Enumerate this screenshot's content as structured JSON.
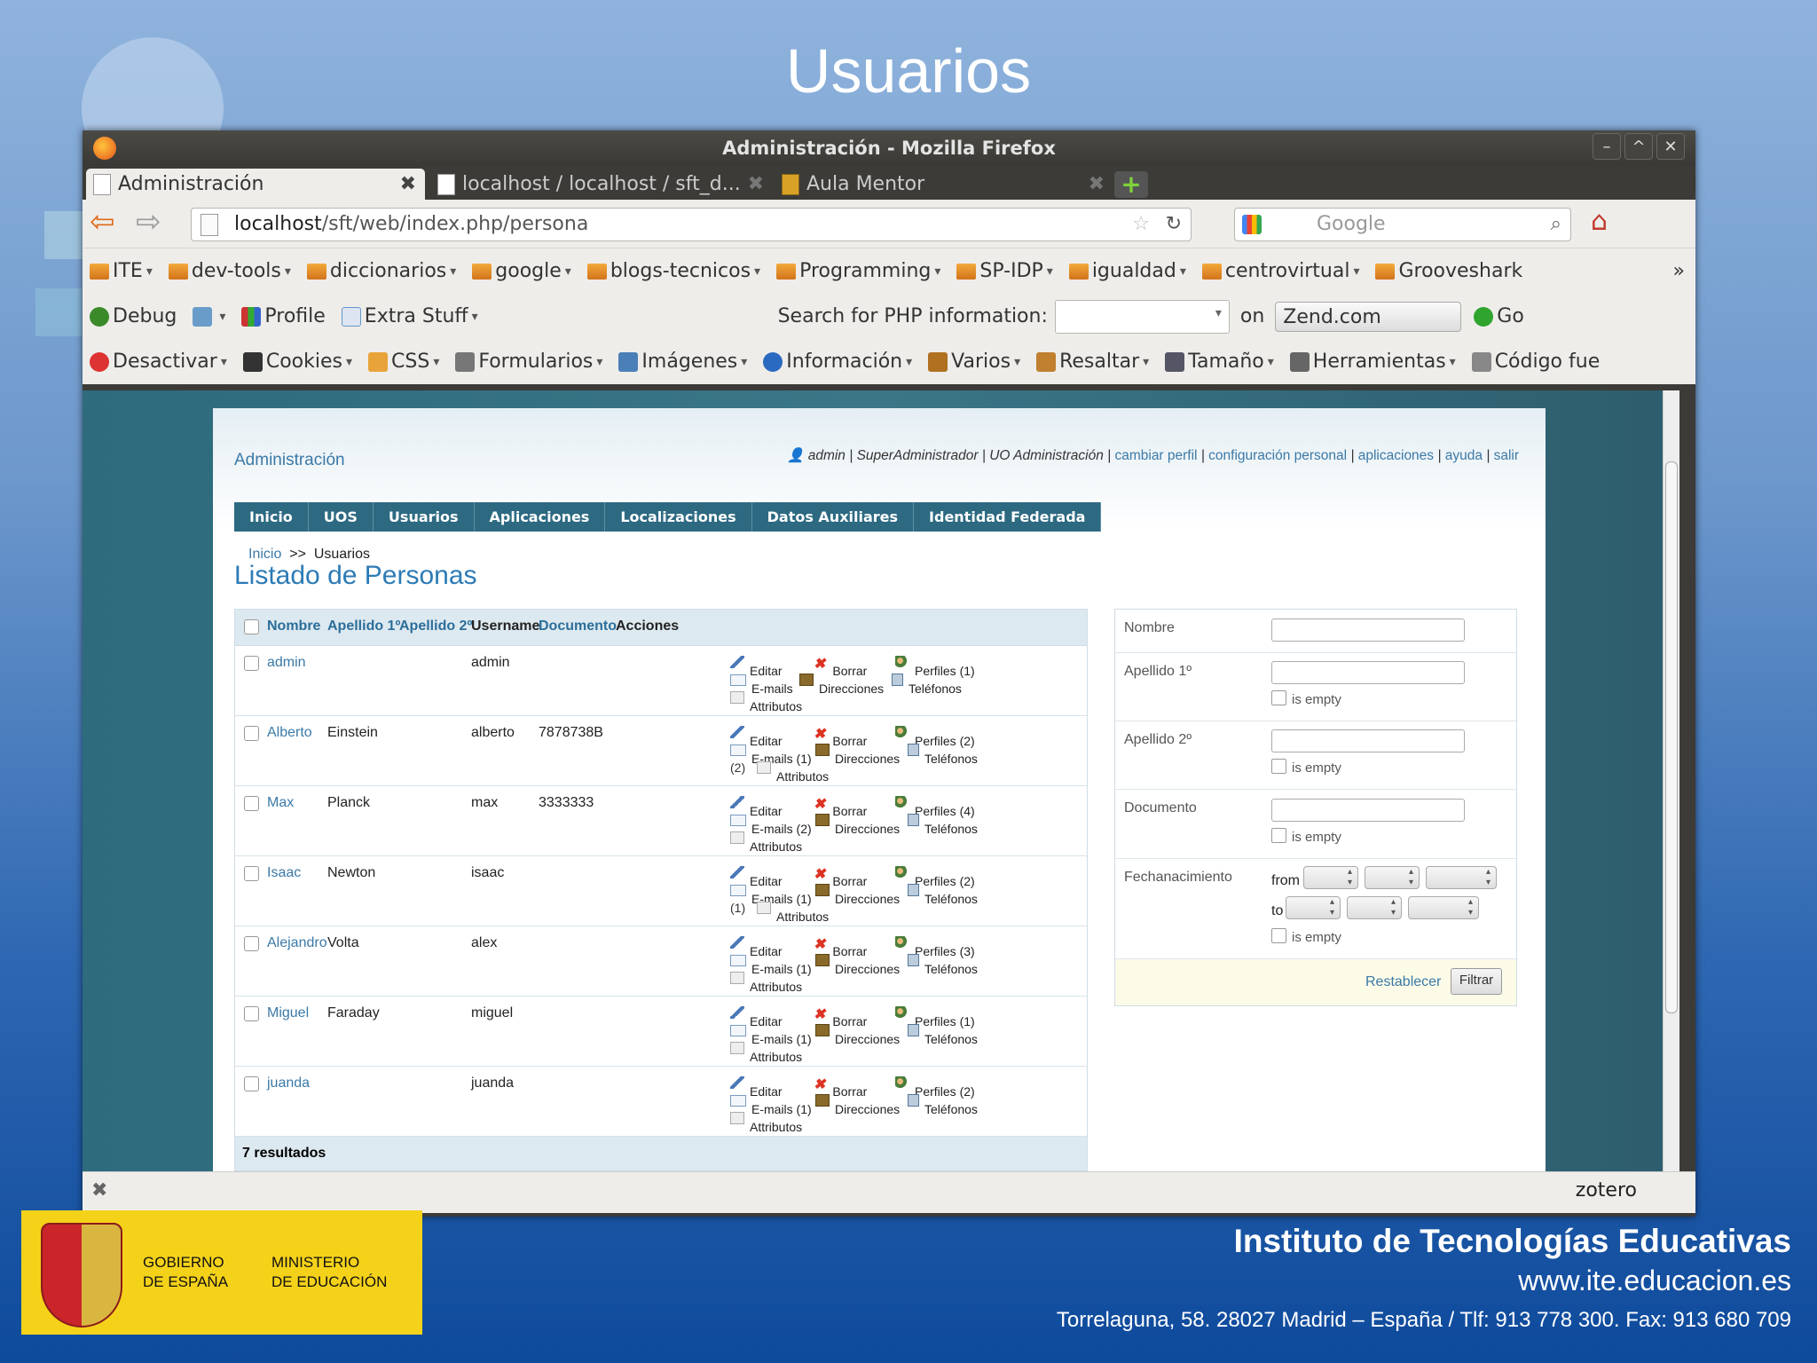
{
  "slide": {
    "title": "Usuarios",
    "footer": {
      "gov_line1": "GOBIERNO",
      "gov_line2": "DE ESPAÑA",
      "min_line1": "MINISTERIO",
      "min_line2": "DE EDUCACIÓN",
      "institute": "Instituto de Tecnologías Educativas",
      "url": "www.ite.educacion.es",
      "address": "Torrelaguna, 58. 28027 Madrid – España / Tlf: 913 778 300. Fax: 913 680 709"
    }
  },
  "window": {
    "title": "Administración - Mozilla Firefox",
    "tabs": [
      {
        "label": "Administración"
      },
      {
        "label": "localhost / localhost / sft_d..."
      },
      {
        "label": "Aula Mentor"
      }
    ],
    "url_domain": "localhost",
    "url_path": "/sft/web/index.php/persona",
    "search_placeholder": "Google"
  },
  "bookmarks": [
    "ITE",
    "dev-tools",
    "diccionarios",
    "google",
    "blogs-tecnicos",
    "Programming",
    "SP-IDP",
    "igualdad",
    "centrovirtual",
    "Grooveshark"
  ],
  "php_bar": {
    "debug": "Debug",
    "profile": "Profile",
    "extra": "Extra Stuff",
    "search_label": "Search for PHP information:",
    "on": "on",
    "site": "Zend.com",
    "go": "Go"
  },
  "webdev": [
    "Desactivar",
    "Cookies",
    "CSS",
    "Formularios",
    "Imágenes",
    "Información",
    "Varios",
    "Resaltar",
    "Tamaño",
    "Herramientas",
    "Código fue"
  ],
  "app": {
    "admin_link": "Administración",
    "user": "admin",
    "role": "SuperAdministrador",
    "uo": "UO Administración",
    "links": [
      "cambiar perfil",
      "configuración personal",
      "aplicaciones",
      "ayuda",
      "salir"
    ],
    "menu": [
      "Inicio",
      "UOS",
      "Usuarios",
      "Aplicaciones",
      "Localizaciones",
      "Datos Auxiliares",
      "Identidad Federada"
    ],
    "crumb_home": "Inicio",
    "crumb_sep": ">>",
    "crumb_current": "Usuarios",
    "heading": "Listado de Personas"
  },
  "table": {
    "headers": {
      "nombre": "Nombre",
      "apellido1": "Apellido 1º",
      "apellido2": "Apellido 2º",
      "username": "Username",
      "documento": "Documento",
      "acciones": "Acciones"
    },
    "rows": [
      {
        "nombre": "admin",
        "apellido1": "",
        "username": "admin",
        "documento": "",
        "perfiles": "Perfiles (1)",
        "emails": "E-mails",
        "dir": "Direcciones",
        "tel": "Teléfonos",
        "attr": "Attributos"
      },
      {
        "nombre": "Alberto",
        "apellido1": "Einstein",
        "username": "alberto",
        "documento": "7878738B",
        "perfiles": "Perfiles (2)",
        "emails": "E-mails (1)",
        "dir": "Direcciones",
        "tel": "Teléfonos",
        "attr": "Attributos",
        "extra": "(2)"
      },
      {
        "nombre": "Max",
        "apellido1": "Planck",
        "username": "max",
        "documento": "3333333",
        "perfiles": "Perfiles (4)",
        "emails": "E-mails (2)",
        "dir": "Direcciones",
        "tel": "Teléfonos",
        "attr": "Attributos"
      },
      {
        "nombre": "Isaac",
        "apellido1": "Newton",
        "username": "isaac",
        "documento": "",
        "perfiles": "Perfiles (2)",
        "emails": "E-mails (1)",
        "dir": "Direcciones",
        "tel": "Teléfonos",
        "attr": "Attributos",
        "extra": "(1)"
      },
      {
        "nombre": "Alejandro",
        "apellido1": "Volta",
        "username": "alex",
        "documento": "",
        "perfiles": "Perfiles (3)",
        "emails": "E-mails (1)",
        "dir": "Direcciones",
        "tel": "Teléfonos",
        "attr": "Attributos"
      },
      {
        "nombre": "Miguel",
        "apellido1": "Faraday",
        "username": "miguel",
        "documento": "",
        "perfiles": "Perfiles (1)",
        "emails": "E-mails (1)",
        "dir": "Direcciones",
        "tel": "Teléfonos",
        "attr": "Attributos"
      },
      {
        "nombre": "juanda",
        "apellido1": "",
        "username": "juanda",
        "documento": "",
        "perfiles": "Perfiles (2)",
        "emails": "E-mails (1)",
        "dir": "Direcciones",
        "tel": "Teléfonos",
        "attr": "Attributos"
      }
    ],
    "action_edit": "Editar",
    "action_delete": "Borrar",
    "results": "7 resultados"
  },
  "filter": {
    "nombre": "Nombre",
    "apellido1": "Apellido 1º",
    "apellido2": "Apellido 2º",
    "documento": "Documento",
    "fecha": "Fechanacimiento",
    "from": "from",
    "to": "to",
    "is_empty": "is empty",
    "reset": "Restablecer",
    "submit": "Filtrar"
  },
  "statusbar": {
    "zotero": "zotero"
  }
}
